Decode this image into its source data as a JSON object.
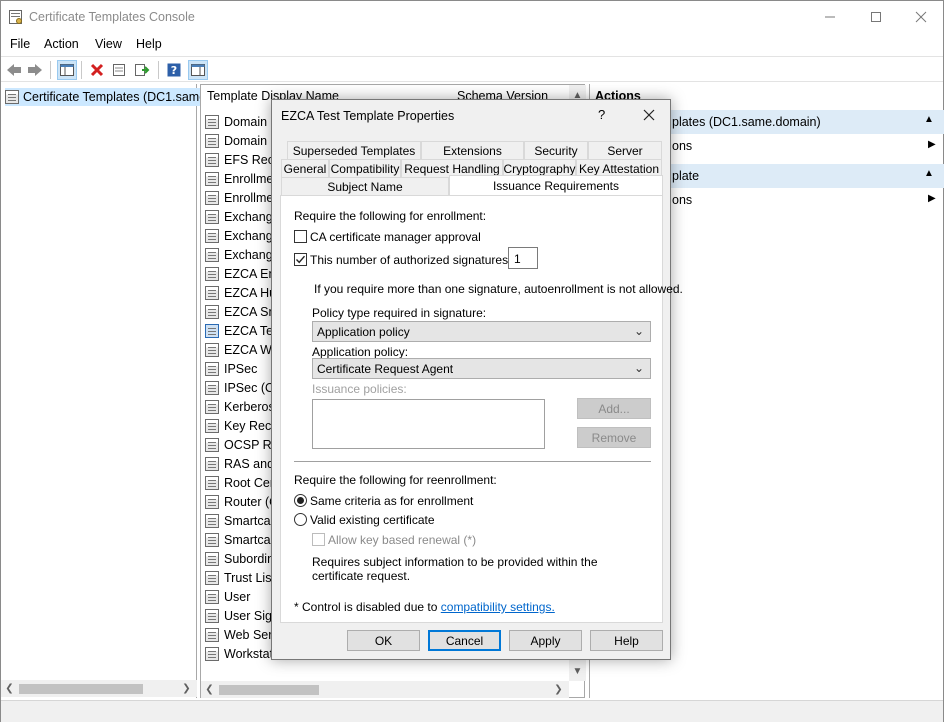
{
  "window": {
    "title": "Certificate Templates Console"
  },
  "menu": [
    "File",
    "Action",
    "View",
    "Help"
  ],
  "tree": {
    "root_label": "Certificate Templates (DC1.same"
  },
  "list": {
    "columns": {
      "name": "Template Display Name",
      "schema": "Schema Version"
    },
    "rows": [
      "Domain C",
      "Domain C",
      "EFS Reco",
      "Enrollmen",
      "Enrollmen",
      "Exchange",
      "Exchange",
      "Exchange",
      "EZCA Enr",
      "EZCA Hu",
      "EZCA Sm",
      "EZCA Tes",
      "EZCA We",
      "IPSec",
      "IPSec (Of",
      "Kerberos",
      "Key Reco",
      "OCSP Res",
      "RAS and I",
      "Root Cert",
      "Router (O",
      "Smartcard",
      "Smartcard",
      "Subordina",
      "Trust List",
      "User",
      "User Sign",
      "Web Serv",
      "Workstati"
    ]
  },
  "actions": {
    "title": "Actions",
    "section1_label": "plates (DC1.same.domain)",
    "section1_item": "ons",
    "section2_label": "plate",
    "section2_item": "ons"
  },
  "dialog": {
    "title": "EZCA Test Template Properties",
    "help_glyph": "?",
    "tabs_row1": [
      "Superseded Templates",
      "Extensions",
      "Security",
      "Server"
    ],
    "tabs_row2": [
      "General",
      "Compatibility",
      "Request Handling",
      "Cryptography",
      "Key Attestation"
    ],
    "tabs_row3": [
      "Subject Name",
      "Issuance Requirements"
    ],
    "require_enrollment": "Require the following for enrollment:",
    "ca_manager_approval": "CA certificate manager approval",
    "ca_manager_checked": false,
    "authorized_signatures": "This number of authorized signatures:",
    "authorized_signatures_checked": true,
    "signatures_value": "1",
    "autoenroll_note": "If you require more than one signature, autoenrollment is not allowed.",
    "policy_type_label": "Policy type required in signature:",
    "policy_type_value": "Application policy",
    "app_policy_label": "Application policy:",
    "app_policy_value": "Certificate Request Agent",
    "issuance_policies_label": "Issuance policies:",
    "add_button": "Add...",
    "remove_button": "Remove",
    "require_reenrollment": "Require the following for reenrollment:",
    "same_criteria": "Same criteria as for enrollment",
    "valid_existing": "Valid existing certificate",
    "allow_key_renewal": "Allow key based renewal (*)",
    "subject_info_note": "Requires subject information to be provided within the certificate request.",
    "disabled_note_prefix": "* Control is disabled due to ",
    "compat_link": "compatibility settings.",
    "ok": "OK",
    "cancel": "Cancel",
    "apply": "Apply",
    "help": "Help"
  }
}
